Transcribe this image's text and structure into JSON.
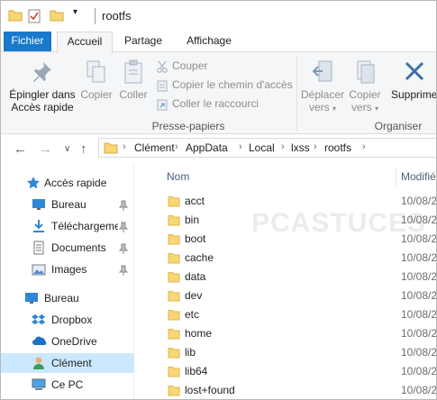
{
  "title": "rootfs",
  "tabs": [
    "Fichier",
    "Accueil",
    "Partage",
    "Affichage"
  ],
  "ribbon": {
    "pin_label": [
      "Épingler dans",
      "Accès rapide"
    ],
    "copy_label": "Copier",
    "paste_label": "Coller",
    "cut_label": "Couper",
    "copy_path_label": "Copier le chemin d'accès",
    "paste_shortcut_label": "Coller le raccourci",
    "clipboard_group": "Presse-papiers",
    "move_to_label": [
      "Déplacer",
      "vers"
    ],
    "copy_to_label": [
      "Copier",
      "vers"
    ],
    "delete_label": "Supprimer",
    "organize_group": "Organiser"
  },
  "breadcrumb": [
    "Clément",
    "AppData",
    "Local",
    "lxss",
    "rootfs"
  ],
  "nav": {
    "quick_access": "Accès rapide",
    "items": [
      {
        "label": "Bureau",
        "icon": "desktop-icon",
        "pinned": true
      },
      {
        "label": "Téléchargements",
        "icon": "download-icon",
        "pinned": true
      },
      {
        "label": "Documents",
        "icon": "documents-icon",
        "pinned": true
      },
      {
        "label": "Images",
        "icon": "images-icon",
        "pinned": true
      }
    ],
    "roots": [
      {
        "label": "Bureau",
        "icon": "desktop-icon"
      },
      {
        "label": "Dropbox",
        "icon": "dropbox-icon"
      },
      {
        "label": "OneDrive",
        "icon": "onedrive-icon"
      },
      {
        "label": "Clément",
        "icon": "user-icon"
      },
      {
        "label": "Ce PC",
        "icon": "computer-icon"
      }
    ]
  },
  "columns": {
    "name": "Nom",
    "modified": "Modifié"
  },
  "files": [
    {
      "name": "acct",
      "date": "10/08/2"
    },
    {
      "name": "bin",
      "date": "10/08/2"
    },
    {
      "name": "boot",
      "date": "10/08/2"
    },
    {
      "name": "cache",
      "date": "10/08/2"
    },
    {
      "name": "data",
      "date": "10/08/2"
    },
    {
      "name": "dev",
      "date": "10/08/2"
    },
    {
      "name": "etc",
      "date": "10/08/2"
    },
    {
      "name": "home",
      "date": "10/08/2"
    },
    {
      "name": "lib",
      "date": "10/08/2"
    },
    {
      "name": "lib64",
      "date": "10/08/2"
    },
    {
      "name": "lost+found",
      "date": "10/08/2"
    }
  ],
  "colors": {
    "accent": "#1979ca",
    "folder": "#f8d775",
    "selected": "#cce8ff"
  }
}
